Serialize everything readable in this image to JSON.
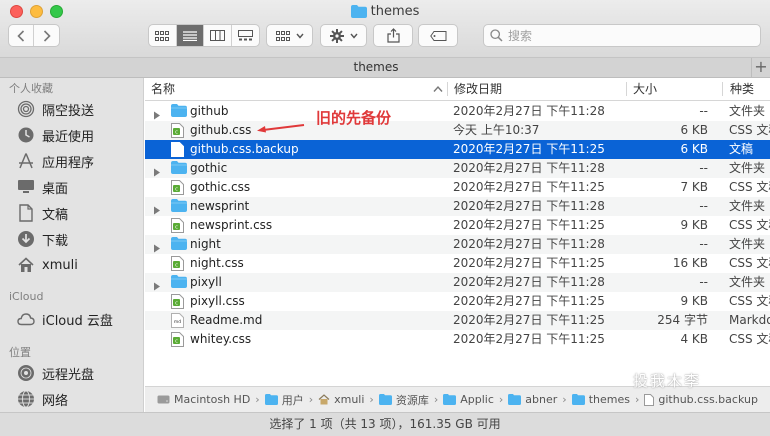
{
  "window": {
    "title": "themes"
  },
  "toolbar": {
    "search_placeholder": "搜索"
  },
  "tabbar": {
    "label": "themes"
  },
  "sidebar": {
    "favorites_header": "个人收藏",
    "favorites": [
      {
        "label": "隔空投送",
        "icon": "airdrop-icon"
      },
      {
        "label": "最近使用",
        "icon": "clock-icon"
      },
      {
        "label": "应用程序",
        "icon": "applications-icon"
      },
      {
        "label": "桌面",
        "icon": "desktop-icon"
      },
      {
        "label": "文稿",
        "icon": "documents-icon"
      },
      {
        "label": "下载",
        "icon": "download-icon"
      },
      {
        "label": "xmuli",
        "icon": "home-icon"
      }
    ],
    "icloud_header": "iCloud",
    "icloud": [
      {
        "label": "iCloud 云盘",
        "icon": "icloud-icon"
      }
    ],
    "locations_header": "位置",
    "locations": [
      {
        "label": "远程光盘",
        "icon": "disc-icon"
      },
      {
        "label": "网络",
        "icon": "network-icon"
      }
    ]
  },
  "columns": {
    "name": "名称",
    "date": "修改日期",
    "size": "大小",
    "kind": "种类"
  },
  "files": [
    {
      "name": "github",
      "date": "2020年2月27日 下午11:28",
      "size": "--",
      "kind": "文件夹",
      "type": "folder"
    },
    {
      "name": "github.css",
      "date": "今天 上午10:37",
      "size": "6 KB",
      "kind": "CSS 文稿",
      "type": "css"
    },
    {
      "name": "github.css.backup",
      "date": "2020年2月27日 下午11:25",
      "size": "6 KB",
      "kind": "文稿",
      "type": "doc",
      "selected": true
    },
    {
      "name": "gothic",
      "date": "2020年2月27日 下午11:28",
      "size": "--",
      "kind": "文件夹",
      "type": "folder"
    },
    {
      "name": "gothic.css",
      "date": "2020年2月27日 下午11:25",
      "size": "7 KB",
      "kind": "CSS 文稿",
      "type": "css"
    },
    {
      "name": "newsprint",
      "date": "2020年2月27日 下午11:28",
      "size": "--",
      "kind": "文件夹",
      "type": "folder"
    },
    {
      "name": "newsprint.css",
      "date": "2020年2月27日 下午11:25",
      "size": "9 KB",
      "kind": "CSS 文稿",
      "type": "css"
    },
    {
      "name": "night",
      "date": "2020年2月27日 下午11:28",
      "size": "--",
      "kind": "文件夹",
      "type": "folder"
    },
    {
      "name": "night.css",
      "date": "2020年2月27日 下午11:25",
      "size": "16 KB",
      "kind": "CSS 文稿",
      "type": "css"
    },
    {
      "name": "pixyll",
      "date": "2020年2月27日 下午11:28",
      "size": "--",
      "kind": "文件夹",
      "type": "folder"
    },
    {
      "name": "pixyll.css",
      "date": "2020年2月27日 下午11:25",
      "size": "9 KB",
      "kind": "CSS 文稿",
      "type": "css"
    },
    {
      "name": "Readme.md",
      "date": "2020年2月27日 下午11:25",
      "size": "254 字节",
      "kind": "Markdown",
      "type": "md"
    },
    {
      "name": "whitey.css",
      "date": "2020年2月27日 下午11:25",
      "size": "4 KB",
      "kind": "CSS 文稿",
      "type": "css"
    }
  ],
  "annotation": "旧的先备份",
  "pathbar": [
    {
      "label": "Macintosh HD",
      "icon": "hard-drive-icon"
    },
    {
      "label": "用户",
      "icon": "folder-icon"
    },
    {
      "label": "xmuli",
      "icon": "home-icon"
    },
    {
      "label": "资源库",
      "icon": "folder-icon"
    },
    {
      "label": "Applic",
      "icon": "folder-icon"
    },
    {
      "label": "abner",
      "icon": "folder-icon"
    },
    {
      "label": "themes",
      "icon": "folder-icon"
    },
    {
      "label": "github.css.backup",
      "icon": "document-icon"
    }
  ],
  "status": "选择了 1 项（共 13 项），161.35 GB 可用",
  "watermark": "投我木李",
  "colors": {
    "selection": "#0a63d6",
    "folder": "#4cb3f0",
    "annotation": "#e0393a",
    "css_icon": "#5aab35"
  }
}
